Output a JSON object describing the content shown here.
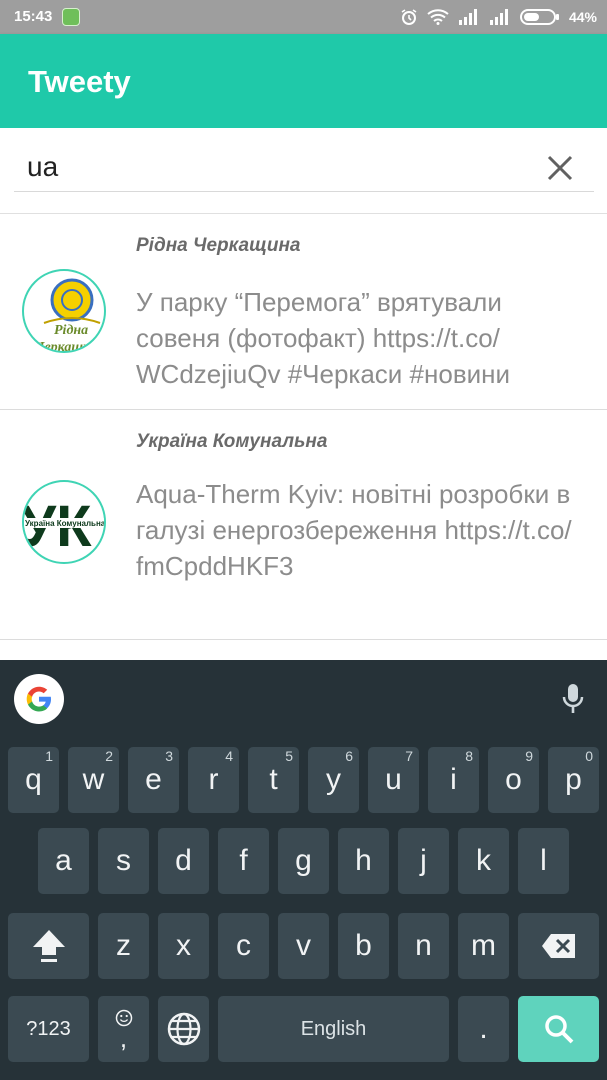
{
  "status_bar": {
    "time": "15:43",
    "battery": "44%"
  },
  "app": {
    "title": "Tweety"
  },
  "search": {
    "value": "ua",
    "placeholder": ""
  },
  "tweets": [
    {
      "author": "Рідна Черкащина",
      "text": "У парку “Перемога” врятували совеня (фотофакт) https://t.co/ WCdzejiuQv #Черкаси #новини",
      "avatar_text": "Рідна Черкащина"
    },
    {
      "author": "Україна Комунальна",
      "text": "Aqua-Therm Kyiv: новітні розробки в галузі енергозбереження https://t.co/ fmCpddHKF3",
      "avatar_letters": "УК",
      "avatar_caption": "Україна Комунальна"
    }
  ],
  "keyboard": {
    "row1": [
      {
        "label": "q",
        "hint": "1"
      },
      {
        "label": "w",
        "hint": "2"
      },
      {
        "label": "e",
        "hint": "3"
      },
      {
        "label": "r",
        "hint": "4"
      },
      {
        "label": "t",
        "hint": "5"
      },
      {
        "label": "y",
        "hint": "6"
      },
      {
        "label": "u",
        "hint": "7"
      },
      {
        "label": "i",
        "hint": "8"
      },
      {
        "label": "o",
        "hint": "9"
      },
      {
        "label": "p",
        "hint": "0"
      }
    ],
    "row2": [
      "a",
      "s",
      "d",
      "f",
      "g",
      "h",
      "j",
      "k",
      "l"
    ],
    "row3": [
      "z",
      "x",
      "c",
      "v",
      "b",
      "n",
      "m"
    ],
    "symbols_label": "?123",
    "comma_label": ",",
    "space_label": "English",
    "period_label": "."
  },
  "colors": {
    "accent": "#1fc9a9",
    "keyboard_bg": "#263238",
    "key_bg": "#3b4a52",
    "search_key": "#5fd3bd"
  },
  "icons": [
    "app-notification-icon",
    "alarm-icon",
    "wifi-icon",
    "signal-icon",
    "battery-icon",
    "close-icon",
    "google-icon",
    "mic-icon",
    "shift-icon",
    "backspace-icon",
    "emoji-icon",
    "globe-icon",
    "search-icon"
  ]
}
